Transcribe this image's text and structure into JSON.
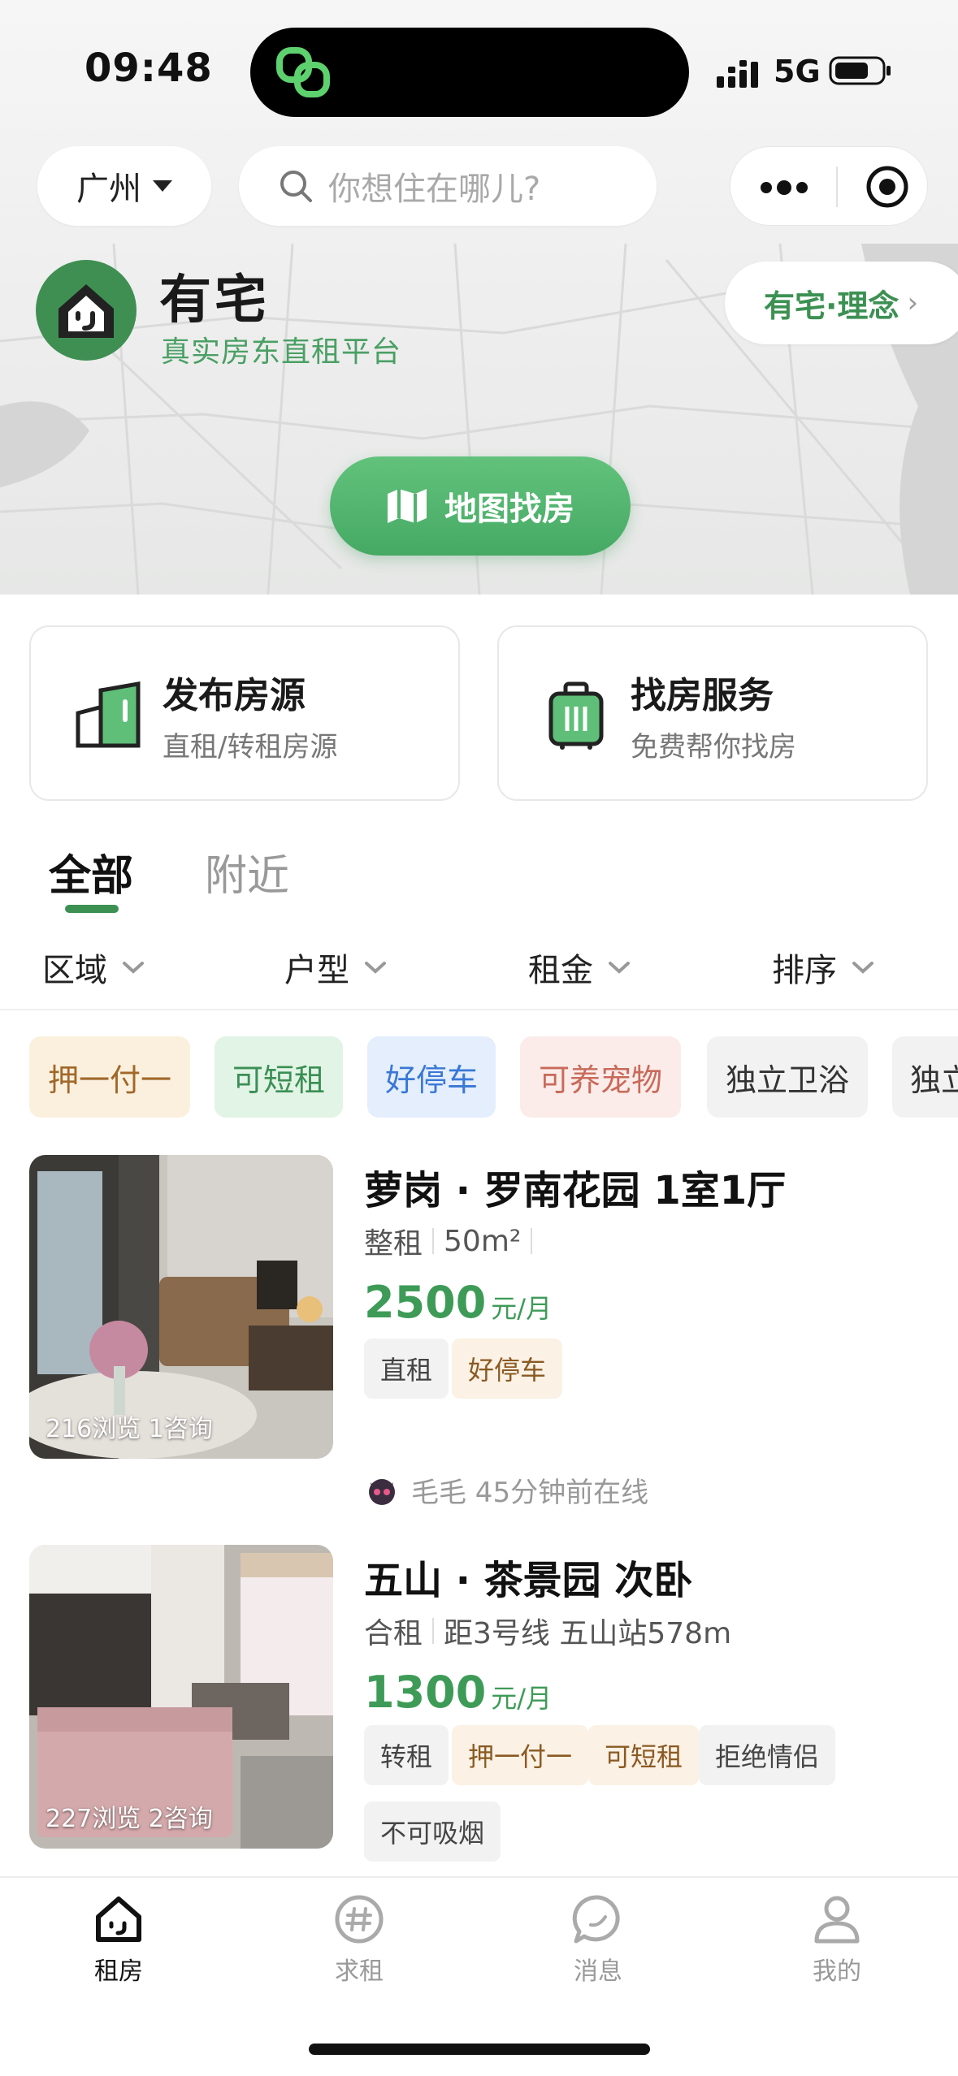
{
  "status_bar": {
    "time": "09:48",
    "network": "5G"
  },
  "header": {
    "city": "广州",
    "search_placeholder": "你想住在哪儿?"
  },
  "brand": {
    "name": "有宅",
    "slogan": "真实房东直租平台",
    "concept_button": "有宅·理念"
  },
  "map_button": "地图找房",
  "services": [
    {
      "title": "发布房源",
      "subtitle": "直租/转租房源",
      "icon": "house-icon"
    },
    {
      "title": "找房服务",
      "subtitle": "免费帮你找房",
      "icon": "luggage-icon"
    }
  ],
  "tabs": [
    {
      "label": "全部",
      "active": true
    },
    {
      "label": "附近",
      "active": false
    }
  ],
  "filters": [
    "区域",
    "户型",
    "租金",
    "排序"
  ],
  "chips": [
    {
      "label": "押一付一",
      "color": "#a0682a",
      "bg": "#fbf0dd"
    },
    {
      "label": "可短租",
      "color": "#3b8f54",
      "bg": "#e2f4e6"
    },
    {
      "label": "好停车",
      "color": "#3a78d6",
      "bg": "#e4eefc"
    },
    {
      "label": "可养宠物",
      "color": "#c96a5a",
      "bg": "#fbecea"
    },
    {
      "label": "独立卫浴",
      "color": "#333333",
      "bg": "#f2f2f2"
    },
    {
      "label": "独立",
      "color": "#333333",
      "bg": "#f2f2f2"
    }
  ],
  "listings": [
    {
      "title": "萝岗 · 罗南花园 1室1厅",
      "rent_type": "整租",
      "detail": "50m²",
      "price": "2500",
      "price_unit": "元/月",
      "stats": "216浏览  1咨询",
      "tags": [
        {
          "label": "直租",
          "style": "gray"
        },
        {
          "label": "好停车",
          "style": "beige"
        }
      ],
      "owner": "毛毛 45分钟前在线"
    },
    {
      "title": "五山 · 茶景园 次卧",
      "rent_type": "合租",
      "detail": "距3号线 五山站578m",
      "price": "1300",
      "price_unit": "元/月",
      "stats": "227浏览  2咨询",
      "tags": [
        {
          "label": "转租",
          "style": "gray"
        },
        {
          "label": "押一付一",
          "style": "beige"
        },
        {
          "label": "可短租",
          "style": "beige"
        },
        {
          "label": "拒绝情侣",
          "style": "gray"
        },
        {
          "label": "不可吸烟",
          "style": "gray"
        }
      ]
    }
  ],
  "bottom_nav": [
    {
      "label": "租房",
      "icon": "home-icon",
      "active": true
    },
    {
      "label": "求租",
      "icon": "hashtag-icon",
      "active": false
    },
    {
      "label": "消息",
      "icon": "chat-icon",
      "active": false
    },
    {
      "label": "我的",
      "icon": "profile-icon",
      "active": false
    }
  ],
  "colors": {
    "brand_green": "#3e9b57",
    "map_button": "#4fb36c"
  }
}
